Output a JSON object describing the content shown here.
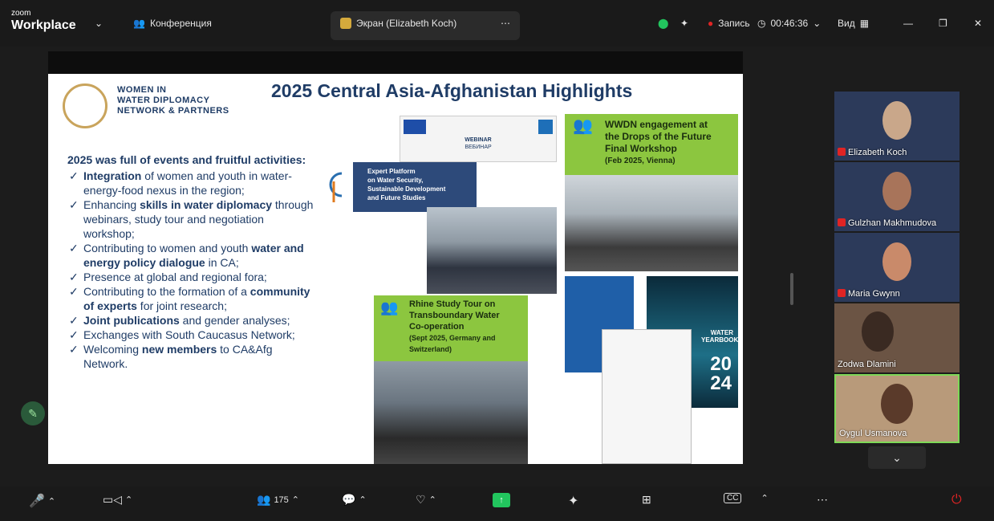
{
  "app": {
    "logo_top": "zoom",
    "logo_bottom": "Workplace"
  },
  "topbar": {
    "conference_label": "Конференция",
    "screen_label": "Экран (Elizabeth Koch)",
    "record_label": "Запись",
    "timer": "00:46:36",
    "view_label": "Вид"
  },
  "slide": {
    "org_name": [
      "WOMEN IN",
      "WATER DIPLOMACY",
      "NETWORK & PARTNERS"
    ],
    "title": "2025 Central Asia-Afghanistan Highlights",
    "lead": "2025 was full of events and fruitful activities:",
    "bullets": [
      {
        "pre": "",
        "bold": "Integration",
        "post": " of women and youth in water-energy-food nexus in the region;"
      },
      {
        "pre": "Enhancing ",
        "bold": "skills in water diplomacy",
        "post": " through webinars, study tour and negotiation workshop;"
      },
      {
        "pre": "Contributing to women and youth ",
        "bold": "water and energy policy dialogue",
        "post": " in CA;"
      },
      {
        "pre": "Presence at global and regional fora;",
        "bold": "",
        "post": ""
      },
      {
        "pre": "Contributing to the formation of a ",
        "bold": "community of experts",
        "post": " for joint research;"
      },
      {
        "pre": "",
        "bold": "Joint publications",
        "post": " and gender analyses;"
      },
      {
        "pre": "Exchanges with South Caucasus Network;",
        "bold": "",
        "post": ""
      },
      {
        "pre": "Welcoming ",
        "bold": "new members",
        "post": " to CA&Afg Network."
      }
    ],
    "webinar_title": "WEBINAR",
    "webinar_subtitle": "ВЕБИНАР",
    "expert_platform": [
      "Expert Platform",
      "on Water Security,",
      "Sustainable Development",
      "and Future Studies"
    ],
    "wwdn_box": [
      "WWDN engagement at",
      "the Drops of the Future",
      "Final Workshop",
      "(Feb 2025, Vienna)"
    ],
    "rhine_box": [
      "Rhine Study Tour on",
      "Transboundary Water",
      "Co-operation",
      "(Sept 2025, Germany and",
      "Switzerland)"
    ],
    "yearbook_text": "WATER YEARBOOK",
    "yearbook_year_a": "20",
    "yearbook_year_b": "24"
  },
  "participants": [
    {
      "name": "Elizabeth Koch",
      "muted": true
    },
    {
      "name": "Gulzhan Makhmudova",
      "muted": true
    },
    {
      "name": "Maria Gwynn",
      "muted": true
    },
    {
      "name": "Zodwa Dlamini",
      "muted": false
    },
    {
      "name": "Oygul Usmanova",
      "muted": false
    }
  ],
  "bottombar": {
    "participants_count": "175",
    "labels": [
      "Звук",
      "Видео",
      "Участники",
      "Чат",
      "Отреагировать",
      "Поделиться",
      "AI Companion",
      "Приложения",
      "Показать субтитры",
      "Дополнительно",
      "Выйти"
    ]
  },
  "colors": {
    "accent_green": "#8cc63f",
    "slide_navy": "#1f3c66",
    "record_red": "#e02424",
    "active_speaker": "#7ed957"
  }
}
